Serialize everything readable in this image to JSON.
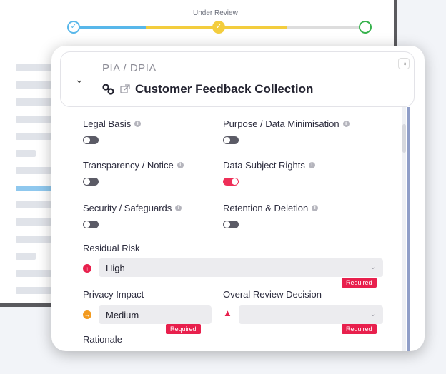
{
  "progress": {
    "current_step_label": "Under Review",
    "colors": {
      "done": "#58b7ea",
      "current": "#f3cd3e",
      "pending": "#dddddd",
      "end": "#37b24d"
    }
  },
  "card": {
    "kicker": "PIA / DPIA",
    "title": "Customer Feedback Collection"
  },
  "toggles": [
    {
      "label": "Legal Basis",
      "on": false
    },
    {
      "label": "Purpose / Data Minimisation",
      "on": false
    },
    {
      "label": "Transparency / Notice",
      "on": false
    },
    {
      "label": "Data Subject Rights",
      "on": true
    },
    {
      "label": "Security / Safeguards",
      "on": false
    },
    {
      "label": "Retention & Deletion",
      "on": false
    }
  ],
  "residual_risk": {
    "label": "Residual Risk",
    "value": "High",
    "required": "Required",
    "indicator_color": "#e8204d"
  },
  "privacy_impact": {
    "label": "Privacy Impact",
    "value": "Medium",
    "required": "Required",
    "indicator_color": "#f29a1f"
  },
  "review_decision": {
    "label": "Overal Review Decision",
    "value": "",
    "required": "Required"
  },
  "rationale": {
    "label": "Rationale"
  },
  "colors": {
    "accent_red": "#e8204d",
    "toggle_off": "#5b5b66",
    "toggle_on": "#ee2f58"
  }
}
